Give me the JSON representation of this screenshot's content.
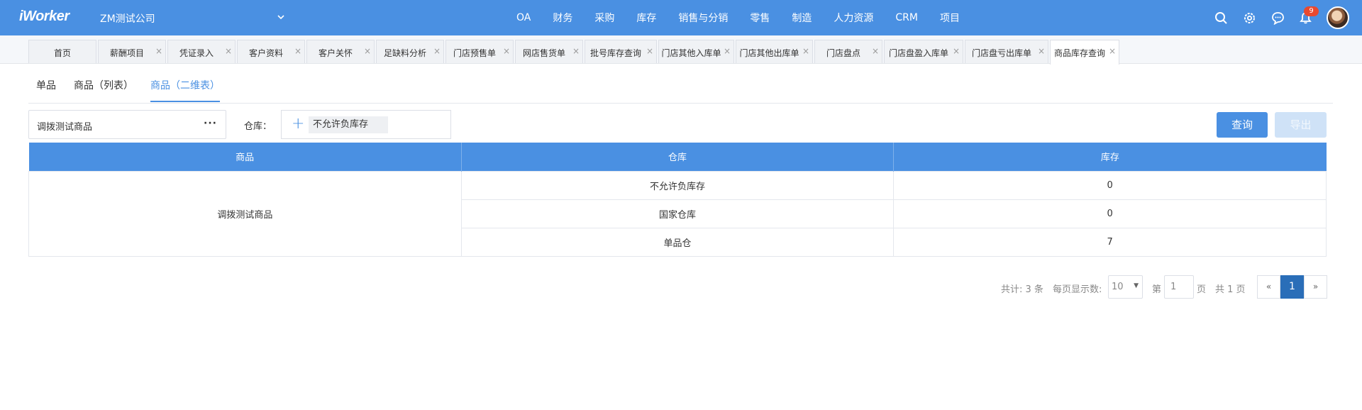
{
  "app": {
    "logo": "iWorker",
    "company": "ZM测试公司"
  },
  "nav": [
    "OA",
    "财务",
    "采购",
    "库存",
    "销售与分销",
    "零售",
    "制造",
    "人力资源",
    "CRM",
    "项目"
  ],
  "notifications": {
    "count": "9"
  },
  "tabs": [
    {
      "label": "首页"
    },
    {
      "label": "薪酬项目"
    },
    {
      "label": "凭证录入"
    },
    {
      "label": "客户资料"
    },
    {
      "label": "客户关怀"
    },
    {
      "label": "足缺料分析"
    },
    {
      "label": "门店预售单"
    },
    {
      "label": "网店售货单"
    },
    {
      "label": "批号库存查询"
    },
    {
      "label": "门店其他入库单"
    },
    {
      "label": "门店其他出库单"
    },
    {
      "label": "门店盘点"
    },
    {
      "label": "门店盘盈入库单"
    },
    {
      "label": "门店盘亏出库单"
    },
    {
      "label": "商品库存查询"
    }
  ],
  "close_glyph": "×",
  "subtabs": [
    "单品",
    "商品（列表）",
    "商品（二维表）"
  ],
  "filters": {
    "product_value": "调拨测试商品",
    "more": "···",
    "warehouse_label": "仓库：",
    "warehouse_chip": "不允许负库存"
  },
  "buttons": {
    "query": "查询",
    "export": "导出"
  },
  "table": {
    "headers": [
      "商品",
      "仓库",
      "库存"
    ],
    "product": "调拨测试商品",
    "rows": [
      {
        "warehouse": "不允许负库存",
        "stock": "0"
      },
      {
        "warehouse": "国家仓库",
        "stock": "0"
      },
      {
        "warehouse": "单品仓",
        "stock": "7"
      }
    ]
  },
  "pagination": {
    "total": "共计: 3 条",
    "per_page_label": "每页显示数:",
    "per_page": "10",
    "page_prefix": "第",
    "page_value": "1",
    "page_suffix": "页",
    "pages_total": "共 1 页",
    "prev": "«",
    "current": "1",
    "next": "»"
  }
}
